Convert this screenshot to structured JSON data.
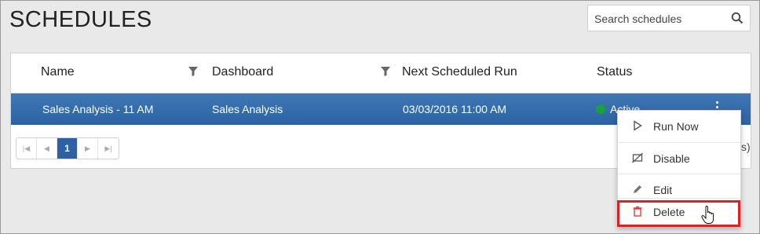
{
  "page": {
    "title": "SCHEDULES"
  },
  "search": {
    "placeholder": "Search schedules",
    "icon": "search-icon"
  },
  "table": {
    "columns": [
      {
        "label": "Name",
        "filterable": false
      },
      {
        "label": "Dashboard",
        "filterable": true
      },
      {
        "label": "Next Scheduled Run",
        "filterable": true
      },
      {
        "label": "Status",
        "filterable": false
      }
    ],
    "rows": [
      {
        "name": "Sales Analysis - 11 AM",
        "dashboard": "Sales Analysis",
        "next_run": "03/03/2016 11:00 AM",
        "status": "Active",
        "status_color": "#18a33a",
        "selected": true
      }
    ],
    "selected_row_color": "#2c62a3"
  },
  "pager": {
    "current_page": "1",
    "info_suffix": "s)"
  },
  "context_menu": {
    "items": [
      {
        "label": "Run Now",
        "icon": "play-icon"
      },
      {
        "label": "Disable",
        "icon": "disable-icon"
      },
      {
        "label": "Edit",
        "icon": "edit-icon"
      },
      {
        "label": "Delete",
        "icon": "trash-icon",
        "highlighted": true
      }
    ],
    "highlight_color": "#e02020"
  }
}
